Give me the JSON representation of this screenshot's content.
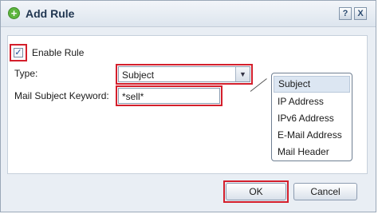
{
  "dialog": {
    "title": "Add Rule",
    "help_label": "?",
    "close_label": "X"
  },
  "form": {
    "enable_rule_label": "Enable Rule",
    "enable_rule_checked": true,
    "type_label": "Type:",
    "type_value": "Subject",
    "keyword_label": "Mail Subject Keyword:",
    "keyword_value": "*sell*"
  },
  "dropdown": {
    "options": [
      "Subject",
      "IP Address",
      "IPv6 Address",
      "E-Mail Address",
      "Mail Header"
    ],
    "selected": "Subject"
  },
  "buttons": {
    "ok_label": "OK",
    "cancel_label": "Cancel"
  },
  "colors": {
    "highlight": "#d41f2c",
    "title_icon": "#5db53e"
  }
}
